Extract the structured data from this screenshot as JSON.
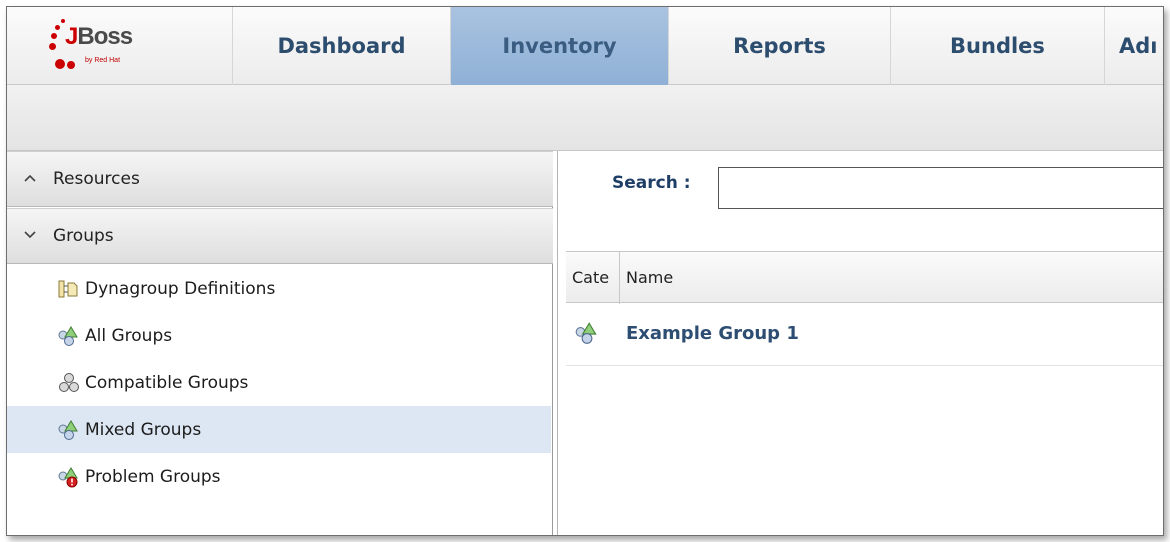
{
  "logo": {
    "word_first": "J",
    "word_rest": "Boss",
    "sub": "by Red Hat"
  },
  "nav": {
    "tabs": [
      {
        "label": "Dashboard"
      },
      {
        "label": "Inventory"
      },
      {
        "label": "Reports"
      },
      {
        "label": "Bundles"
      },
      {
        "label": "Adı"
      }
    ],
    "active": "Inventory"
  },
  "sidebar": {
    "sections": [
      {
        "label": "Resources",
        "chevron": "^"
      },
      {
        "label": "Groups",
        "chevron": "v"
      }
    ],
    "items": [
      {
        "label": "Dynagroup Definitions",
        "icon": "dynagroup-icon"
      },
      {
        "label": "All Groups",
        "icon": "group-icon"
      },
      {
        "label": "Compatible Groups",
        "icon": "compatible-group-icon"
      },
      {
        "label": "Mixed Groups",
        "icon": "mixed-group-icon"
      },
      {
        "label": "Problem Groups",
        "icon": "problem-group-icon"
      }
    ],
    "selected": "Mixed Groups"
  },
  "search": {
    "label": "Search :",
    "value": ""
  },
  "grid": {
    "columns": [
      "Cate",
      "Name"
    ],
    "rows": [
      {
        "name": "Example Group 1",
        "icon": "mixed-group-icon"
      }
    ]
  }
}
